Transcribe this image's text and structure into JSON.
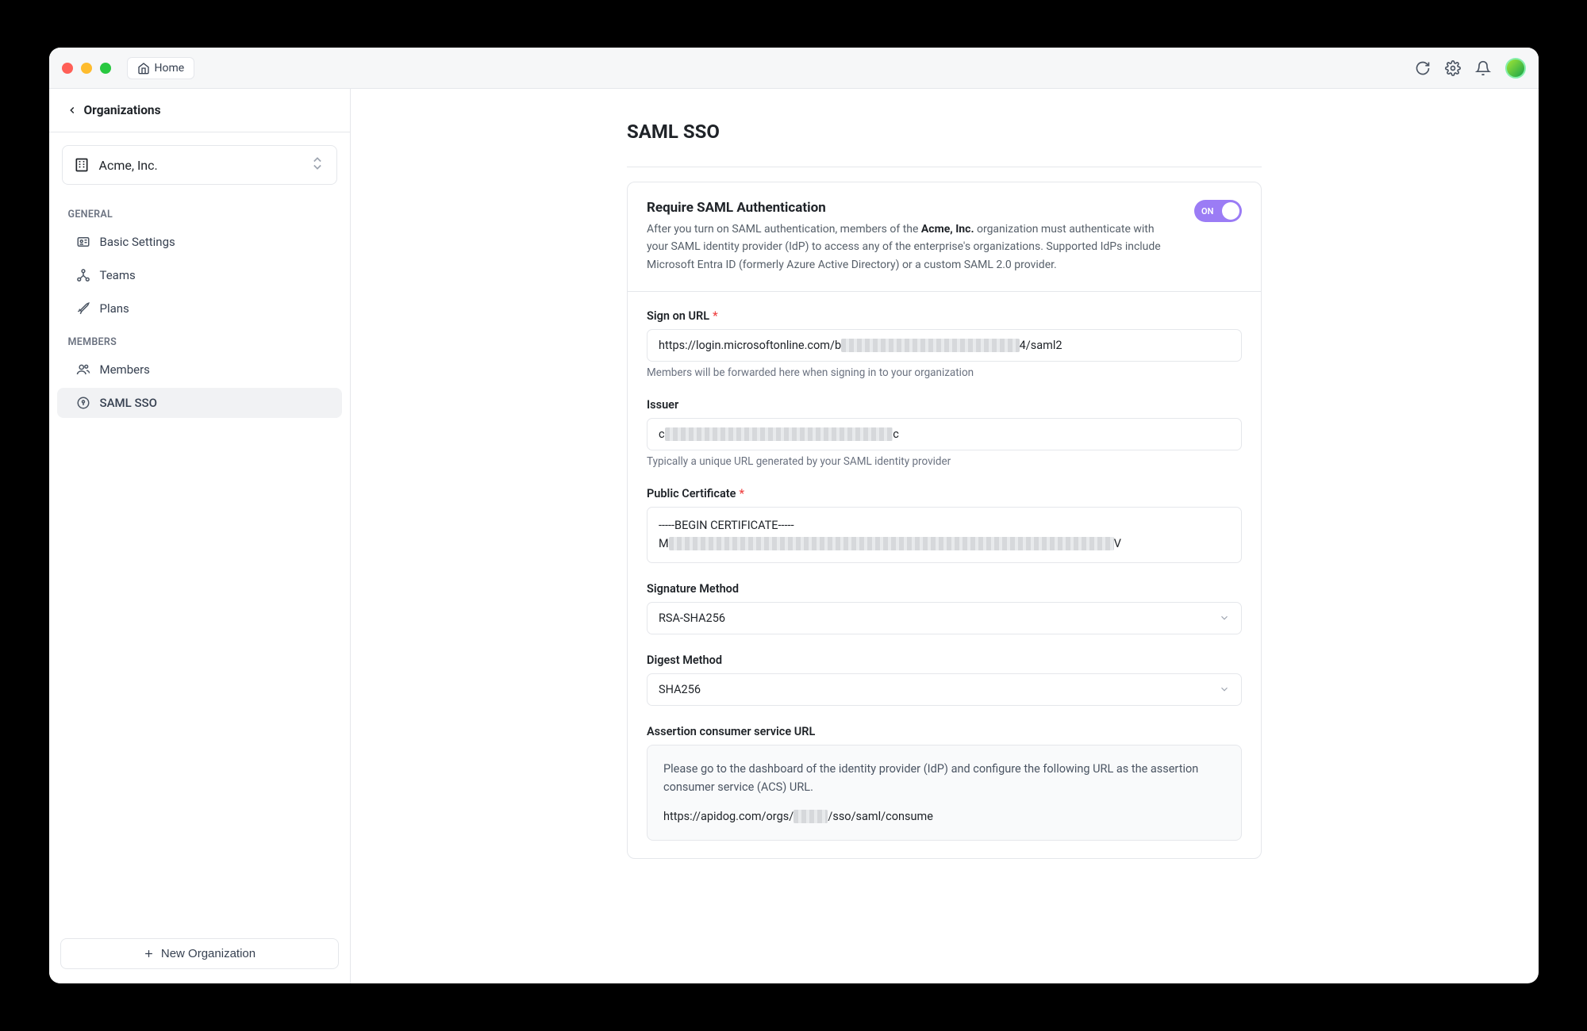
{
  "titlebar": {
    "home_label": "Home"
  },
  "sidebar": {
    "back_label": "Organizations",
    "org_name": "Acme, Inc.",
    "sections": {
      "general_label": "GENERAL",
      "members_label": "MEMBERS"
    },
    "nav": {
      "basic_settings": "Basic Settings",
      "teams": "Teams",
      "plans": "Plans",
      "members": "Members",
      "saml_sso": "SAML SSO"
    },
    "new_org_label": "New Organization"
  },
  "page": {
    "title": "SAML SSO",
    "require_auth": {
      "title": "Require SAML Authentication",
      "desc_pre": "After you turn on SAML authentication, members of the ",
      "org_name": "Acme, Inc.",
      "desc_post": " organization must authenticate with your SAML identity provider (IdP) to access any of the enterprise's organizations. Supported IdPs include Microsoft Entra ID (formerly Azure Active Directory) or a custom SAML 2.0 provider.",
      "toggle_state": "ON"
    },
    "fields": {
      "sign_on_url": {
        "label": "Sign on URL",
        "value_pre": "https://login.microsoftonline.com/b",
        "value_hidden": "xxxxxx-xxxx-xxxx-xxxx-xxxxxxxxxxx",
        "value_post": "4/saml2",
        "help": "Members will be forwarded here when signing in to your organization"
      },
      "issuer": {
        "label": "Issuer",
        "value_pre": "c",
        "value_hidden": "xxxxxxxxxxxxxxxxxxxxxxxxxxxxxxxxxxxxxxxx",
        "value_post": "c",
        "help": "Typically a unique URL generated by your SAML identity provider"
      },
      "public_certificate": {
        "label": "Public Certificate",
        "line1": "-----BEGIN CERTIFICATE-----",
        "line2_pre": "M",
        "line2_hidden": "xxxxxxxxxxxxxxxxxxxxxxxxxxxxxxxxxxxxxxxxxxxxxxxxxxxxxxxxxxxxxxxxxxxxxxxxxxxxxx",
        "line2_post": "V"
      },
      "signature_method": {
        "label": "Signature Method",
        "value": "RSA-SHA256"
      },
      "digest_method": {
        "label": "Digest Method",
        "value": "SHA256"
      },
      "acs": {
        "label": "Assertion consumer service URL",
        "info": "Please go to the dashboard of the identity provider (IdP) and configure the following URL as the assertion consumer service (ACS) URL.",
        "url_pre": "https://apidog.com/orgs/",
        "url_hidden": "xxxxxx",
        "url_post": "/sso/saml/consume"
      }
    }
  }
}
